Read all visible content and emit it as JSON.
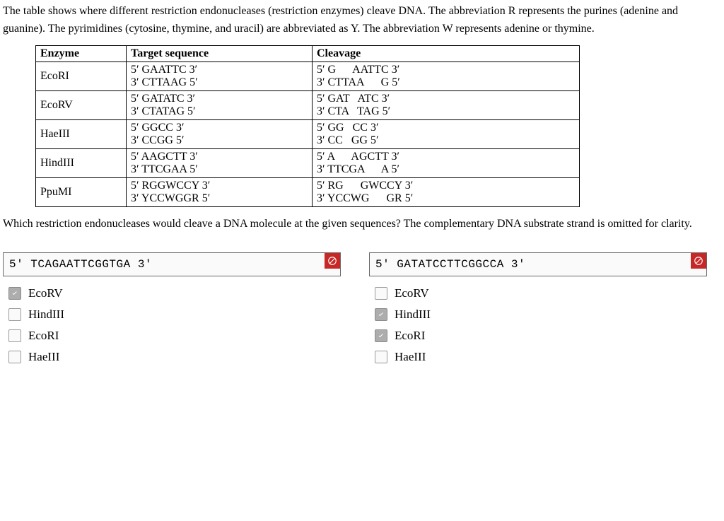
{
  "intro": "The table shows where different restriction endonucleases (restriction enzymes) cleave DNA. The abbreviation R represents the purines (adenine and guanine). The pyrimidines (cytosine, thymine, and uracil) are abbreviated as Y. The abbreviation W represents adenine or thymine.",
  "table": {
    "headers": [
      "Enzyme",
      "Target sequence",
      "Cleavage"
    ],
    "rows": [
      {
        "enzyme": "EcoRI",
        "target_top": "5′ GAATTC 3′",
        "target_bot": "3′ CTTAAG 5′",
        "cleave_top": "5′ G      AATTC 3′",
        "cleave_bot": "3′ CTTAA      G 5′"
      },
      {
        "enzyme": "EcoRV",
        "target_top": "5′ GATATC 3′",
        "target_bot": "3′ CTATAG 5′",
        "cleave_top": "5′ GAT   ATC 3′",
        "cleave_bot": "3′ CTA   TAG 5′"
      },
      {
        "enzyme": "HaeIII",
        "target_top": "5′ GGCC 3′",
        "target_bot": "3′ CCGG 5′",
        "cleave_top": "5′ GG   CC 3′",
        "cleave_bot": "3′ CC   GG 5′"
      },
      {
        "enzyme": "HindIII",
        "target_top": "5′ AAGCTT 3′",
        "target_bot": "3′ TTCGAA 5′",
        "cleave_top": "5′ A      AGCTT 3′",
        "cleave_bot": "3′ TTCGA      A 5′"
      },
      {
        "enzyme": "PpuMI",
        "target_top": "5′ RGGWCCY 3′",
        "target_bot": "3′ YCCWGGR 5′",
        "cleave_top": "5′ RG      GWCCY 3′",
        "cleave_bot": "3′ YCCWG      GR 5′"
      }
    ]
  },
  "question": "Which restriction endonucleases would cleave a DNA molecule at the given sequences? The complementary DNA substrate strand is omitted for clarity.",
  "columns": [
    {
      "sequence": "5′ TCAGAATTCGGTGA 3′",
      "status": "incorrect",
      "options": [
        {
          "label": "EcoRV",
          "checked": true
        },
        {
          "label": "HindIII",
          "checked": false
        },
        {
          "label": "EcoRI",
          "checked": false
        },
        {
          "label": "HaeIII",
          "checked": false
        }
      ]
    },
    {
      "sequence": "5′ GATATCCTTCGGCCA 3′",
      "status": "incorrect",
      "options": [
        {
          "label": "EcoRV",
          "checked": false
        },
        {
          "label": "HindIII",
          "checked": true
        },
        {
          "label": "EcoRI",
          "checked": true
        },
        {
          "label": "HaeIII",
          "checked": false
        }
      ]
    }
  ]
}
